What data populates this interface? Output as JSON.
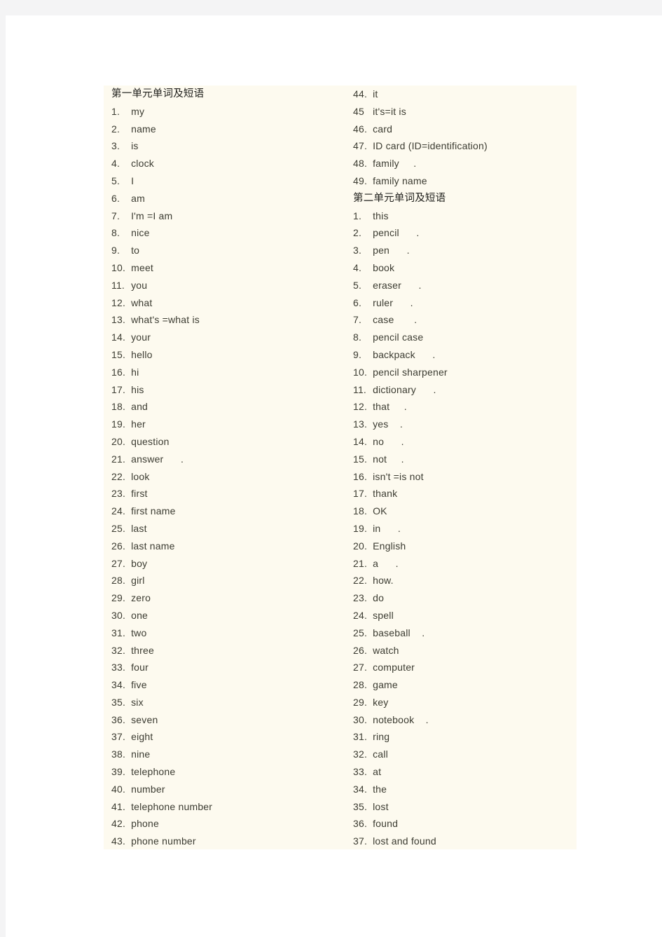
{
  "document": {
    "page_background": "#ffffff",
    "canvas_background": "#f4f4f5",
    "content_block_background": "#fdfaef",
    "text_color": "#3c3c32",
    "heading_color": "#20201c"
  },
  "columns": {
    "left": {
      "heading": "第一单元单词及短语",
      "entries": [
        {
          "num": "1.",
          "term": "my",
          "tail": ""
        },
        {
          "num": "2.",
          "term": "name",
          "tail": ""
        },
        {
          "num": "3.",
          "term": "is",
          "tail": ""
        },
        {
          "num": "4.",
          "term": "clock",
          "tail": ""
        },
        {
          "num": "5.",
          "term": "I",
          "tail": ""
        },
        {
          "num": "6.",
          "term": "am",
          "tail": ""
        },
        {
          "num": "7.",
          "term": "I'm =I am",
          "tail": ""
        },
        {
          "num": "8.",
          "term": "nice",
          "tail": ""
        },
        {
          "num": "9.",
          "term": "to",
          "tail": ""
        },
        {
          "num": "10.",
          "term": "meet",
          "tail": ""
        },
        {
          "num": "11.",
          "term": "you",
          "tail": ""
        },
        {
          "num": "12.",
          "term": "what",
          "tail": ""
        },
        {
          "num": "13.",
          "term": "what's =what is",
          "tail": ""
        },
        {
          "num": "14.",
          "term": "your",
          "tail": ""
        },
        {
          "num": "15.",
          "term": "hello",
          "tail": ""
        },
        {
          "num": "16.",
          "term": "hi",
          "tail": ""
        },
        {
          "num": "17.",
          "term": "his",
          "tail": ""
        },
        {
          "num": "18.",
          "term": "and",
          "tail": ""
        },
        {
          "num": "19.",
          "term": "her",
          "tail": ""
        },
        {
          "num": "20.",
          "term": "question",
          "tail": ""
        },
        {
          "num": "21.",
          "term": "answer",
          "tail": "      ."
        },
        {
          "num": "22.",
          "term": "look",
          "tail": ""
        },
        {
          "num": "23.",
          "term": "first",
          "tail": ""
        },
        {
          "num": "24.",
          "term": "first name",
          "tail": ""
        },
        {
          "num": "25.",
          "term": "last",
          "tail": ""
        },
        {
          "num": "26.",
          "term": "last name",
          "tail": ""
        },
        {
          "num": "27.",
          "term": "boy",
          "tail": ""
        },
        {
          "num": "28.",
          "term": "girl",
          "tail": ""
        },
        {
          "num": "29.",
          "term": "zero",
          "tail": ""
        },
        {
          "num": "30.",
          "term": "one",
          "tail": ""
        },
        {
          "num": "31.",
          "term": "two",
          "tail": ""
        },
        {
          "num": "32.",
          "term": "three",
          "tail": ""
        },
        {
          "num": "33.",
          "term": "four",
          "tail": ""
        },
        {
          "num": "34.",
          "term": "five",
          "tail": ""
        },
        {
          "num": "35.",
          "term": "six",
          "tail": ""
        },
        {
          "num": "36.",
          "term": "seven",
          "tail": ""
        },
        {
          "num": "37.",
          "term": "eight",
          "tail": ""
        },
        {
          "num": "38.",
          "term": "nine",
          "tail": ""
        },
        {
          "num": "39.",
          "term": "telephone",
          "tail": ""
        },
        {
          "num": "40.",
          "term": "number",
          "tail": ""
        },
        {
          "num": "41.",
          "term": "telephone number",
          "tail": ""
        },
        {
          "num": "42.",
          "term": "phone",
          "tail": ""
        },
        {
          "num": "43.",
          "term": "phone number",
          "tail": ""
        }
      ]
    },
    "right": {
      "top_entries": [
        {
          "num": "44.",
          "term": "it",
          "tail": ""
        },
        {
          "num": "45",
          "term": "it's=it is",
          "tail": ""
        },
        {
          "num": "46.",
          "term": "card",
          "tail": ""
        },
        {
          "num": "47.",
          "term": "ID card (ID=identification)",
          "tail": ""
        },
        {
          "num": "48.",
          "term": "family",
          "tail": "     ."
        },
        {
          "num": "49.",
          "term": "family name",
          "tail": ""
        }
      ],
      "heading": "第二单元单词及短语",
      "entries": [
        {
          "num": "1.",
          "term": "this",
          "tail": ""
        },
        {
          "num": "2.",
          "term": "pencil",
          "tail": "      ."
        },
        {
          "num": "3.",
          "term": "pen",
          "tail": "      ."
        },
        {
          "num": "4.",
          "term": "book",
          "tail": ""
        },
        {
          "num": "5.",
          "term": "eraser",
          "tail": "      ."
        },
        {
          "num": "6.",
          "term": "ruler",
          "tail": "      ."
        },
        {
          "num": "7.",
          "term": "case",
          "tail": "       ."
        },
        {
          "num": "8.",
          "term": "pencil case",
          "tail": ""
        },
        {
          "num": "9.",
          "term": "backpack",
          "tail": "      ."
        },
        {
          "num": "10.",
          "term": "pencil sharpener",
          "tail": ""
        },
        {
          "num": "11.",
          "term": "dictionary",
          "tail": "      ."
        },
        {
          "num": "12.",
          "term": "that",
          "tail": "     ."
        },
        {
          "num": "13.",
          "term": "yes",
          "tail": "    ."
        },
        {
          "num": "14.",
          "term": "no",
          "tail": "      ."
        },
        {
          "num": "15.",
          "term": "not",
          "tail": "     ."
        },
        {
          "num": "16.",
          "term": "isn't =is not",
          "tail": ""
        },
        {
          "num": "17.",
          "term": "thank",
          "tail": ""
        },
        {
          "num": "18.",
          "term": "OK",
          "tail": ""
        },
        {
          "num": "19.",
          "term": "in",
          "tail": "      ."
        },
        {
          "num": "20.",
          "term": "English",
          "tail": ""
        },
        {
          "num": "21.",
          "term": "a",
          "tail": "      ."
        },
        {
          "num": "22.",
          "term": "how.",
          "tail": ""
        },
        {
          "num": "23.",
          "term": "do",
          "tail": ""
        },
        {
          "num": "24.",
          "term": "spell",
          "tail": ""
        },
        {
          "num": "25.",
          "term": "baseball",
          "tail": "    ."
        },
        {
          "num": "26.",
          "term": "watch",
          "tail": ""
        },
        {
          "num": "27.",
          "term": "computer",
          "tail": ""
        },
        {
          "num": "28.",
          "term": "game",
          "tail": ""
        },
        {
          "num": "29.",
          "term": "key",
          "tail": ""
        },
        {
          "num": "30.",
          "term": "notebook",
          "tail": "    ."
        },
        {
          "num": "31.",
          "term": "ring",
          "tail": ""
        },
        {
          "num": "32.",
          "term": "call",
          "tail": ""
        },
        {
          "num": "33.",
          "term": "at",
          "tail": ""
        },
        {
          "num": "34.",
          "term": "the",
          "tail": ""
        },
        {
          "num": "35.",
          "term": "lost",
          "tail": ""
        },
        {
          "num": "36.",
          "term": "found",
          "tail": ""
        },
        {
          "num": "37.",
          "term": "lost and found",
          "tail": ""
        }
      ]
    }
  }
}
